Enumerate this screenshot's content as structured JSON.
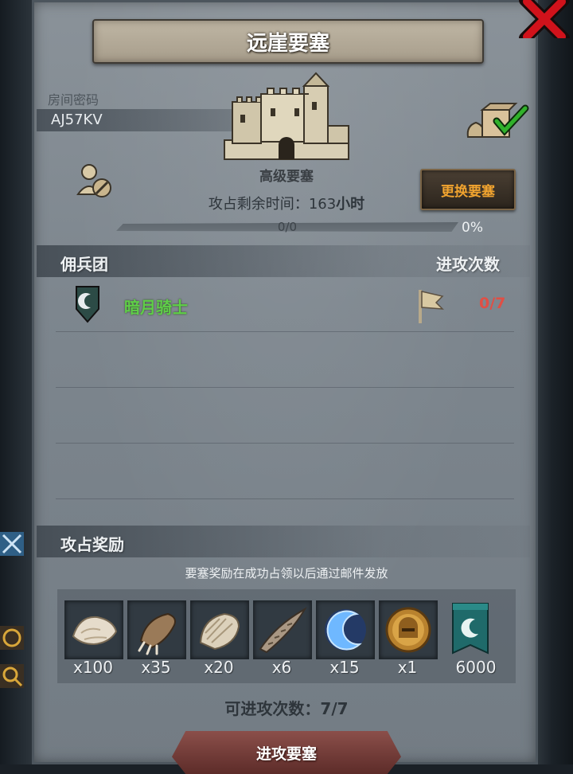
{
  "window": {
    "title": "远崖要塞"
  },
  "room": {
    "label": "房间密码",
    "code": "AJ57KV"
  },
  "fortress": {
    "level": "高级要塞",
    "timer_label": "攻占剩余时间：",
    "timer_value": "163",
    "timer_unit": "小时",
    "change_button": "更换要塞",
    "progress_text": "0/0",
    "progress_percent": "0%",
    "progress_fraction": 0
  },
  "mercenary": {
    "section_title": "佣兵团",
    "attacks_header": "进攻次数",
    "rows": [
      {
        "name": "暗月骑士",
        "attacks": "0/7"
      }
    ]
  },
  "rewards": {
    "section_title": "攻占奖励",
    "note": "要塞奖励在成功占领以后通过邮件发放",
    "items": [
      {
        "icon": "fur-pelt-icon",
        "qty": "x100"
      },
      {
        "icon": "beast-claw-icon",
        "qty": "x35"
      },
      {
        "icon": "scale-shell-icon",
        "qty": "x20"
      },
      {
        "icon": "horn-icon",
        "qty": "x6"
      },
      {
        "icon": "dark-moon-crescent-icon",
        "qty": "x15"
      },
      {
        "icon": "knight-helmet-coin-icon",
        "qty": "x1"
      },
      {
        "icon": "guild-banner-icon",
        "qty": "6000"
      }
    ]
  },
  "footer": {
    "attacks_left_label": "可进攻次数：",
    "attacks_left_value": "7/7",
    "attack_button": "进攻要塞"
  },
  "colors": {
    "merc_name": "#5fcf48",
    "attack_count": "#e04f45",
    "change_button_text": "#f0a32f",
    "close_button": "#d1121b"
  }
}
